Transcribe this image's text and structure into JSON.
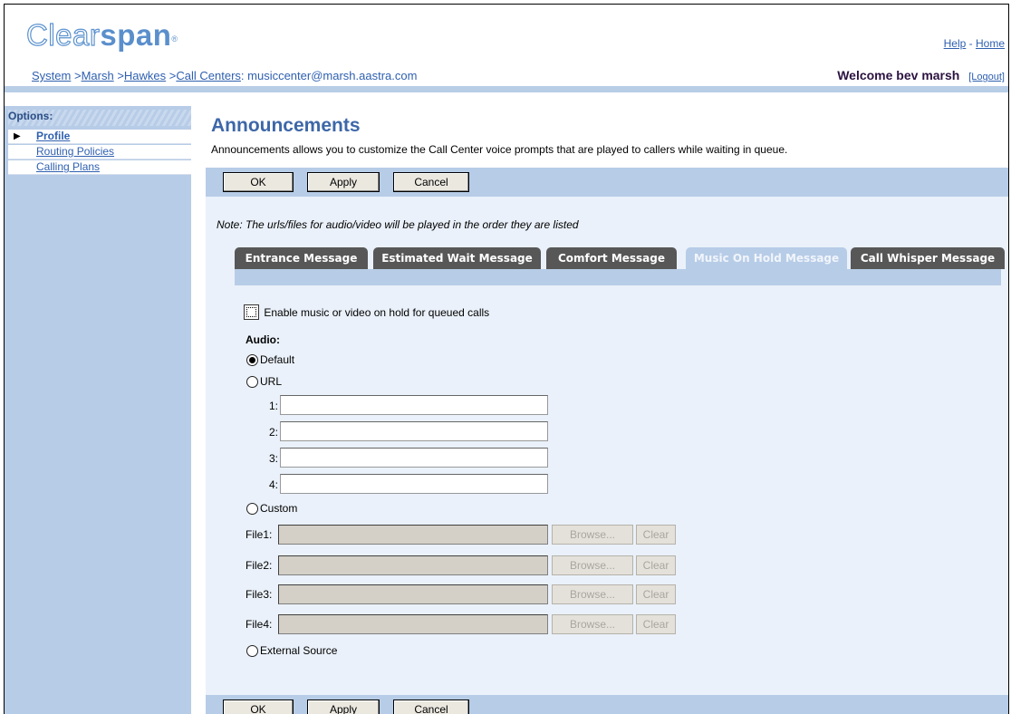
{
  "header": {
    "logo_part1": "Clear",
    "logo_part2": "span",
    "logo_mark": "®",
    "help": "Help",
    "link_sep": "-",
    "home": "Home"
  },
  "breadcrumb": {
    "items": [
      "System",
      "Marsh",
      "Hawkes",
      "Call Centers"
    ],
    "separator": ">",
    "current": ": musiccenter@marsh.aastra.com"
  },
  "user": {
    "welcome": "Welcome bev marsh",
    "logout": "[Logout]"
  },
  "sidebar": {
    "heading": "Options:",
    "items": [
      {
        "label": "Profile",
        "active": true
      },
      {
        "label": "Routing Policies",
        "active": false
      },
      {
        "label": "Calling Plans",
        "active": false
      }
    ]
  },
  "page": {
    "title": "Announcements",
    "description": "Announcements allows you to customize the Call Center voice prompts that are played to callers while waiting in queue.",
    "note": "Note: The urls/files for audio/video will be played in the order they are listed"
  },
  "buttons": {
    "ok": "OK",
    "apply": "Apply",
    "cancel": "Cancel"
  },
  "tabs": [
    {
      "label": "Entrance Message",
      "active": false
    },
    {
      "label": "Estimated Wait Message",
      "active": false
    },
    {
      "label": "Comfort Message",
      "active": false
    },
    {
      "label": "Music On Hold Message",
      "active": true
    },
    {
      "label": "Call Whisper Message",
      "active": false
    }
  ],
  "form": {
    "enable_label": "Enable music or video on hold for queued calls",
    "enable_checked": false,
    "audio_label": "Audio:",
    "radio_default": "Default",
    "radio_url": "URL",
    "radio_custom": "Custom",
    "radio_external": "External Source",
    "selected": "Default",
    "urls": [
      {
        "label": "1:",
        "value": ""
      },
      {
        "label": "2:",
        "value": ""
      },
      {
        "label": "3:",
        "value": ""
      },
      {
        "label": "4:",
        "value": ""
      }
    ],
    "files": [
      {
        "label": "File1:"
      },
      {
        "label": "File2:"
      },
      {
        "label": "File3:"
      },
      {
        "label": "File4:"
      }
    ],
    "browse_label": "Browse...",
    "clear_label": "Clear"
  },
  "colors": {
    "accent_blue": "#3d67a8",
    "panel_blue": "#b7cce7",
    "tab_dark": "#575757",
    "link": "#2f60b0"
  }
}
